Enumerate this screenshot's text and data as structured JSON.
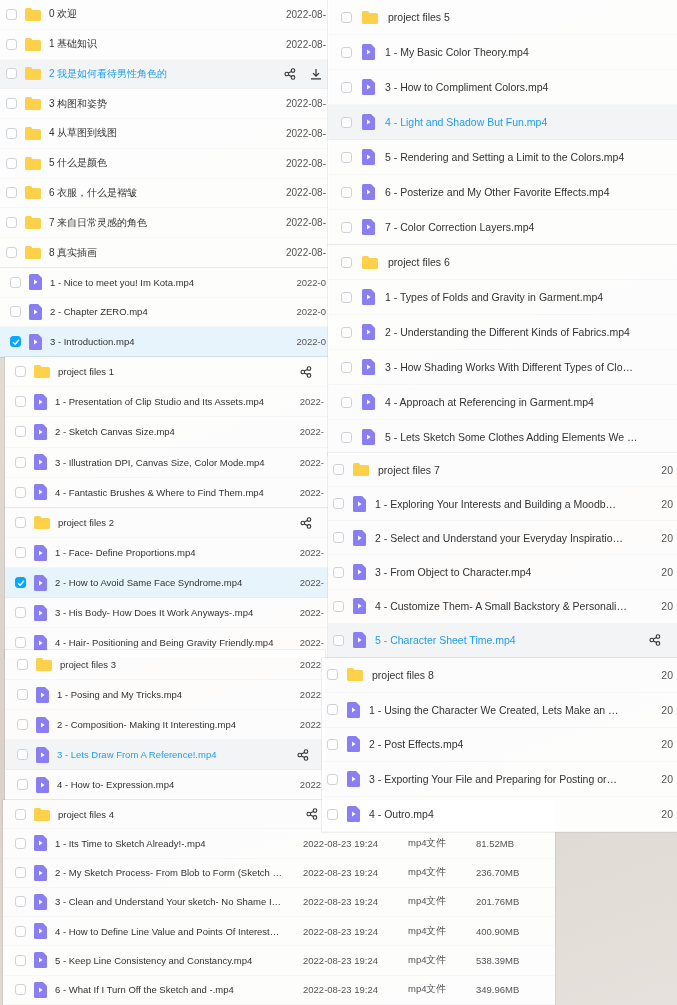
{
  "panels": [
    {
      "rows": [
        {
          "kind": "folder",
          "name": "0 欢迎",
          "checked": false,
          "hovered": false,
          "share": false,
          "download": false,
          "date": "2022-08-"
        },
        {
          "kind": "folder",
          "name": "1 基础知识",
          "checked": false,
          "hovered": false,
          "share": false,
          "download": false,
          "date": "2022-08-"
        },
        {
          "kind": "folder",
          "name": "2 我是如何看待男性角色的",
          "checked": false,
          "hovered": true,
          "share": true,
          "download": true
        },
        {
          "kind": "folder",
          "name": "3 构图和姿势",
          "checked": false,
          "hovered": false,
          "share": false,
          "download": false,
          "date": "2022-08-"
        },
        {
          "kind": "folder",
          "name": "4 从草图到线图",
          "checked": false,
          "hovered": false,
          "share": false,
          "download": false,
          "date": "2022-08-"
        },
        {
          "kind": "folder",
          "name": "5 什么是颜色",
          "checked": false,
          "hovered": false,
          "share": false,
          "download": false,
          "date": "2022-08-"
        },
        {
          "kind": "folder",
          "name": "6 衣服，什么是褶皱",
          "checked": false,
          "hovered": false,
          "share": false,
          "download": false,
          "date": "2022-08-"
        },
        {
          "kind": "folder",
          "name": "7 来自日常灵感的角色",
          "checked": false,
          "hovered": false,
          "share": false,
          "download": false,
          "date": "2022-08-"
        },
        {
          "kind": "folder",
          "name": "8 真实插画",
          "checked": false,
          "hovered": false,
          "share": false,
          "download": false,
          "date": "2022-08-"
        }
      ]
    },
    {
      "rows": [
        {
          "kind": "video",
          "name": "1 - Nice to meet you! Im Kota.mp4",
          "checked": false,
          "hovered": false,
          "share": false,
          "download": false,
          "date": "2022-0"
        },
        {
          "kind": "video",
          "name": "2 - Chapter ZERO.mp4",
          "checked": false,
          "hovered": false,
          "share": false,
          "download": false,
          "date": "2022-0"
        },
        {
          "kind": "video",
          "name": "3 - Introduction.mp4",
          "checked": true,
          "hovered": false,
          "share": false,
          "download": false,
          "date": "2022-0"
        }
      ]
    },
    {
      "rows": [
        {
          "kind": "folder",
          "name": "project files 1",
          "checked": false,
          "hovered": false,
          "share": true,
          "download": false
        },
        {
          "kind": "video",
          "name": "1 - Presentation of Clip Studio and Its Assets.mp4",
          "checked": false,
          "hovered": false,
          "share": false,
          "download": false,
          "date": "2022-"
        },
        {
          "kind": "video",
          "name": "2 - Sketch Canvas Size.mp4",
          "checked": false,
          "hovered": false,
          "share": false,
          "download": false,
          "date": "2022-"
        },
        {
          "kind": "video",
          "name": "3 - Illustration DPI, Canvas Size, Color Mode.mp4",
          "checked": false,
          "hovered": false,
          "share": false,
          "download": false,
          "date": "2022-"
        },
        {
          "kind": "video",
          "name": "4 - Fantastic Brushes & Where to Find Them.mp4",
          "checked": false,
          "hovered": false,
          "share": false,
          "download": false,
          "date": "2022-"
        }
      ]
    },
    {
      "rows": [
        {
          "kind": "folder",
          "name": "project files 2",
          "checked": false,
          "hovered": false,
          "share": true,
          "download": false
        },
        {
          "kind": "video",
          "name": "1 - Face- Define Proportions.mp4",
          "checked": false,
          "hovered": false,
          "share": false,
          "download": false,
          "date": "2022-"
        },
        {
          "kind": "video",
          "name": "2 - How to Avoid Same Face Syndrome.mp4",
          "checked": true,
          "hovered": false,
          "share": false,
          "download": false,
          "date": "2022-"
        },
        {
          "kind": "video",
          "name": "3 - His Body- How Does It Work Anyways-.mp4",
          "checked": false,
          "hovered": false,
          "share": false,
          "download": false,
          "date": "2022-"
        },
        {
          "kind": "video",
          "name": "4 - Hair- Positioning and Being Gravity Friendly.mp4",
          "checked": false,
          "hovered": false,
          "share": false,
          "download": false,
          "date": "2022-"
        }
      ]
    },
    {
      "rows": [
        {
          "kind": "folder",
          "name": "project files 3",
          "checked": false,
          "hovered": false,
          "share": false,
          "download": false,
          "date": "2022"
        },
        {
          "kind": "video",
          "name": "1 - Posing and My Tricks.mp4",
          "checked": false,
          "hovered": false,
          "share": false,
          "download": false,
          "date": "2022"
        },
        {
          "kind": "video",
          "name": "2 - Composition- Making It Interesting.mp4",
          "checked": false,
          "hovered": false,
          "share": false,
          "download": false,
          "date": "2022"
        },
        {
          "kind": "video",
          "name": "3 - Lets Draw From A Reference!.mp4",
          "checked": false,
          "hovered": true,
          "share": true,
          "download": false
        },
        {
          "kind": "video",
          "name": "4 - How to- Expression.mp4",
          "checked": false,
          "hovered": false,
          "share": false,
          "download": false,
          "date": "2022"
        }
      ]
    },
    {
      "rows": [
        {
          "kind": "folder",
          "name": "project files 4",
          "checked": false,
          "hovered": false,
          "share": true,
          "download": false
        },
        {
          "kind": "video",
          "name": "1 - Its Time to Sketch Already!-.mp4",
          "checked": false,
          "hovered": false,
          "share": false,
          "download": false,
          "date": "2022-08-23 19:24",
          "type": "mp4文件",
          "size": "81.52MB"
        },
        {
          "kind": "video",
          "name": "2 - My Sketch Process- From Blob to Form (Sketch …",
          "checked": false,
          "hovered": false,
          "share": false,
          "download": false,
          "date": "2022-08-23 19:24",
          "type": "mp4文件",
          "size": "236.70MB"
        },
        {
          "kind": "video",
          "name": "3 - Clean and Understand Your sketch- No Shame I…",
          "checked": false,
          "hovered": false,
          "share": false,
          "download": false,
          "date": "2022-08-23 19:24",
          "type": "mp4文件",
          "size": "201.76MB"
        },
        {
          "kind": "video",
          "name": "4 - How to Define Line Value and Points Of Interest…",
          "checked": false,
          "hovered": false,
          "share": false,
          "download": false,
          "date": "2022-08-23 19:24",
          "type": "mp4文件",
          "size": "400.90MB"
        },
        {
          "kind": "video",
          "name": "5 - Keep Line Consistency and Constancy.mp4",
          "checked": false,
          "hovered": false,
          "share": false,
          "download": false,
          "date": "2022-08-23 19:24",
          "type": "mp4文件",
          "size": "538.39MB"
        },
        {
          "kind": "video",
          "name": "6 - What If I Turn Off the Sketch and -.mp4",
          "checked": false,
          "hovered": false,
          "share": false,
          "download": false,
          "date": "2022-08-23 19:24",
          "type": "mp4文件",
          "size": "349.96MB"
        }
      ]
    },
    {
      "rows": [
        {
          "kind": "folder",
          "name": "project files 5",
          "checked": false,
          "hovered": false,
          "share": false,
          "download": false
        },
        {
          "kind": "video",
          "name": "1 - My Basic Color Theory.mp4",
          "checked": false,
          "hovered": false,
          "share": false,
          "download": false
        },
        {
          "kind": "video",
          "name": "3 - How to Compliment Colors.mp4",
          "checked": false,
          "hovered": false,
          "share": false,
          "download": false
        },
        {
          "kind": "video",
          "name": "4 - Light and Shadow But Fun.mp4",
          "checked": false,
          "hovered": true,
          "share": false,
          "download": false
        },
        {
          "kind": "video",
          "name": "5 - Rendering and Setting a Limit to the Colors.mp4",
          "checked": false,
          "hovered": false,
          "share": false,
          "download": false
        },
        {
          "kind": "video",
          "name": "6 - Posterize and My Other Favorite Effects.mp4",
          "checked": false,
          "hovered": false,
          "share": false,
          "download": false
        },
        {
          "kind": "video",
          "name": "7 - Color Correction Layers.mp4",
          "checked": false,
          "hovered": false,
          "share": false,
          "download": false
        }
      ]
    },
    {
      "rows": [
        {
          "kind": "folder",
          "name": "project files 6",
          "checked": false,
          "hovered": false,
          "share": false,
          "download": false
        },
        {
          "kind": "video",
          "name": "1 - Types of Folds and Gravity in Garment.mp4",
          "checked": false,
          "hovered": false,
          "share": false,
          "download": false
        },
        {
          "kind": "video",
          "name": "2 - Understanding the Different Kinds of Fabrics.mp4",
          "checked": false,
          "hovered": false,
          "share": false,
          "download": false
        },
        {
          "kind": "video",
          "name": "3 - How Shading Works With Different Types of Clo…",
          "checked": false,
          "hovered": false,
          "share": false,
          "download": false
        },
        {
          "kind": "video",
          "name": "4 - Approach at Referencing in Garment.mp4",
          "checked": false,
          "hovered": false,
          "share": false,
          "download": false
        },
        {
          "kind": "video",
          "name": "5 - Lets Sketch Some Clothes Adding Elements We …",
          "checked": false,
          "hovered": false,
          "share": false,
          "download": false
        }
      ]
    },
    {
      "rows": [
        {
          "kind": "folder",
          "name": "project files 7",
          "checked": false,
          "hovered": false,
          "share": false,
          "download": false,
          "date": "20"
        },
        {
          "kind": "video",
          "name": "1 - Exploring Your Interests and Building a Moodb…",
          "checked": false,
          "hovered": false,
          "share": false,
          "download": false,
          "date": "20"
        },
        {
          "kind": "video",
          "name": "2 - Select and Understand your Everyday Inspiratio…",
          "checked": false,
          "hovered": false,
          "share": false,
          "download": false,
          "date": "20"
        },
        {
          "kind": "video",
          "name": "3 - From Object to Character.mp4",
          "checked": false,
          "hovered": false,
          "share": false,
          "download": false,
          "date": "20"
        },
        {
          "kind": "video",
          "name": "4 - Customize Them- A Small Backstory & Personali…",
          "checked": false,
          "hovered": false,
          "share": false,
          "download": false,
          "date": "20"
        },
        {
          "kind": "video",
          "name": "5 - Character Sheet Time.mp4",
          "checked": false,
          "hovered": true,
          "share": true,
          "download": false
        }
      ]
    },
    {
      "rows": [
        {
          "kind": "folder",
          "name": "project files 8",
          "checked": false,
          "hovered": false,
          "share": false,
          "download": false,
          "date": "20"
        },
        {
          "kind": "video",
          "name": "1 - Using the Character We Created, Lets Make an …",
          "checked": false,
          "hovered": false,
          "share": false,
          "download": false,
          "date": "20"
        },
        {
          "kind": "video",
          "name": "2 - Post Effects.mp4",
          "checked": false,
          "hovered": false,
          "share": false,
          "download": false,
          "date": "20"
        },
        {
          "kind": "video",
          "name": "3 - Exporting Your File and Preparing for Posting or…",
          "checked": false,
          "hovered": false,
          "share": false,
          "download": false,
          "date": "20"
        },
        {
          "kind": "video",
          "name": "4 - Outro.mp4",
          "checked": false,
          "hovered": false,
          "share": false,
          "download": false,
          "date": "20"
        }
      ]
    }
  ]
}
